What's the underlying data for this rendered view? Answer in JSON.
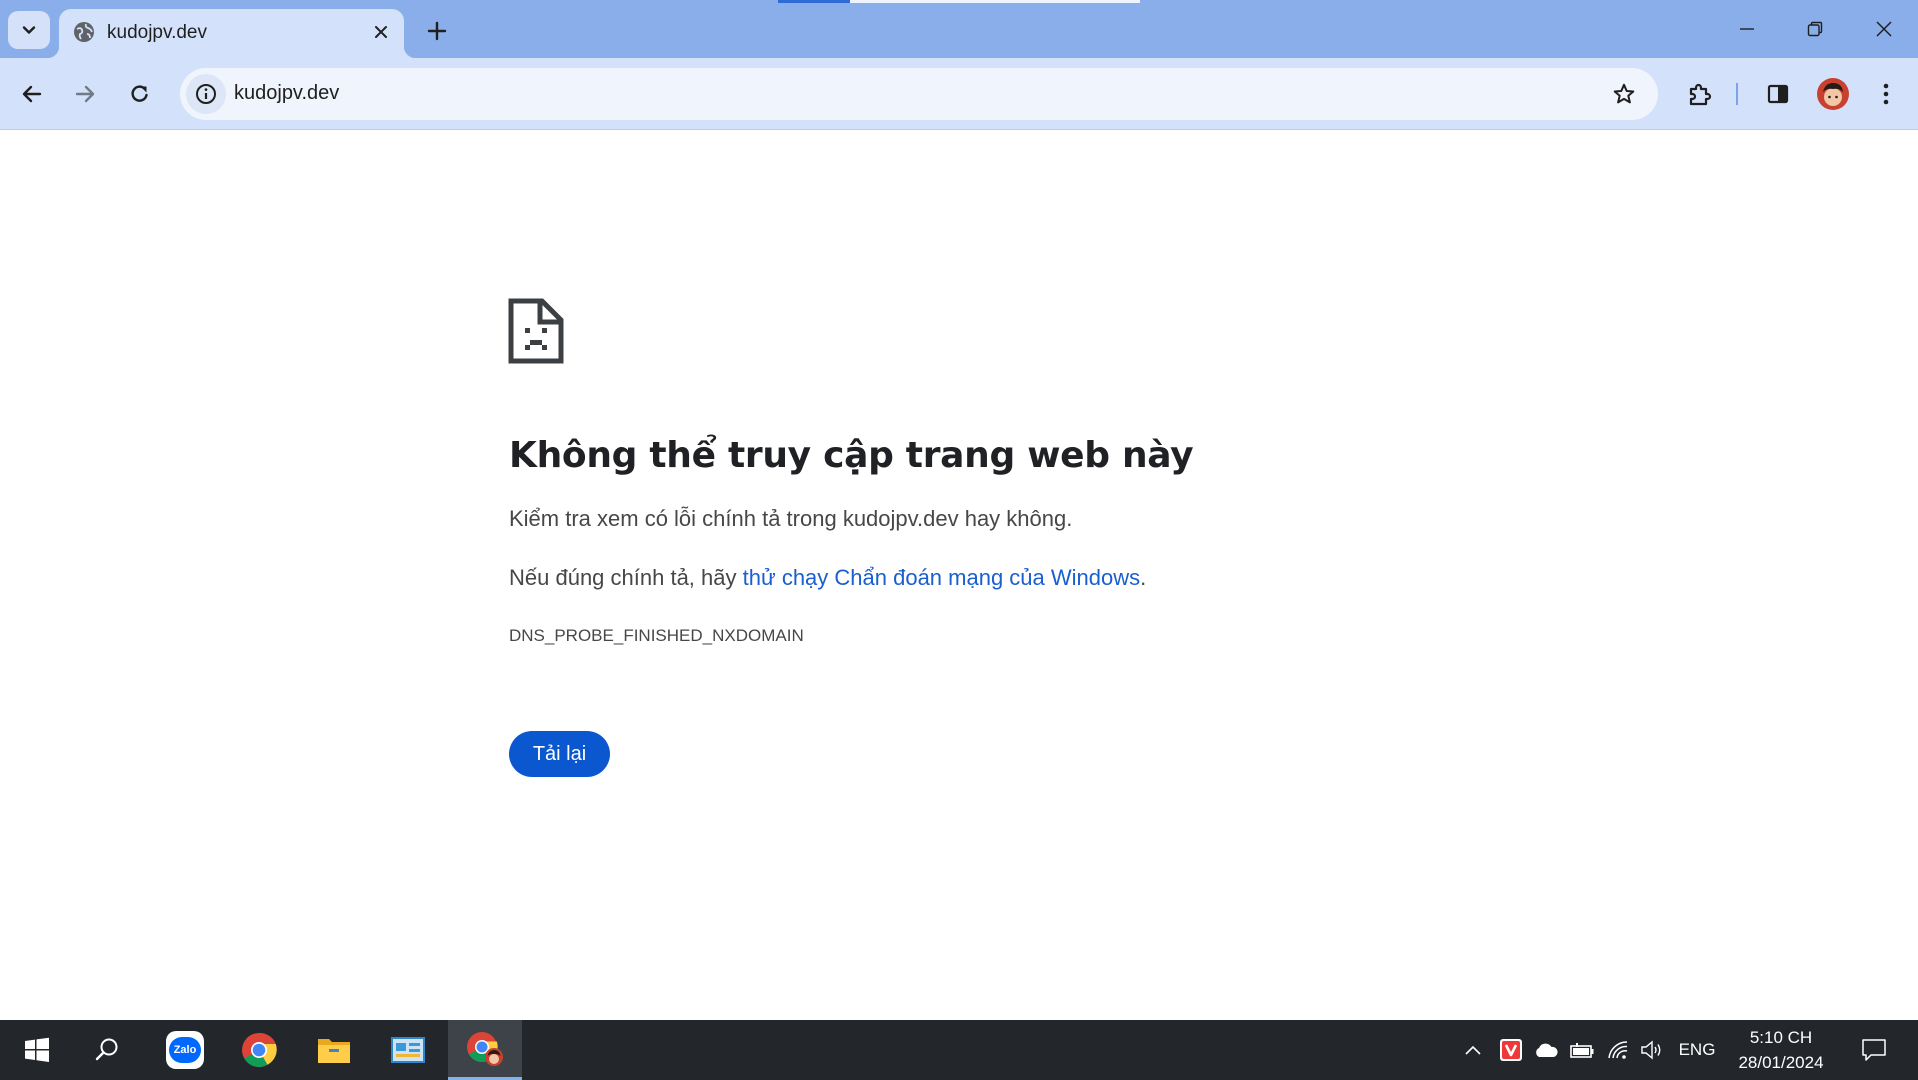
{
  "browser": {
    "tab": {
      "title": "kudojpv.dev",
      "favicon": "globe-icon",
      "close_icon": "close-icon"
    },
    "tab_search_icon": "chevron-down-icon",
    "new_tab_icon": "plus-icon",
    "window_controls": [
      "minimize-icon",
      "restore-icon",
      "close-icon"
    ],
    "toolbar": {
      "back_icon": "arrow-left-icon",
      "forward_icon": "arrow-right-icon",
      "reload_icon": "reload-icon",
      "site_info_icon": "info-icon",
      "url": "kudojpv.dev",
      "bookmark_icon": "star-icon",
      "extensions_icon": "puzzle-icon",
      "side_panel_icon": "side-panel-icon",
      "profile_icon": "avatar",
      "menu_icon": "kebab-menu-icon"
    },
    "colors": {
      "tabstrip": "#8aaee9",
      "toolbar": "#d3e2fa",
      "accent": "#0b57d0",
      "link": "#1a5fd0"
    }
  },
  "error_page": {
    "icon": "sad-document-icon",
    "title": "Không thể truy cập trang web này",
    "line1": "Kiểm tra xem có lỗi chính tả trong kudojpv.dev hay không.",
    "line2_prefix": "Nếu đúng chính tả, hãy ",
    "line2_link": "thử chạy Chẩn đoán mạng của Windows",
    "line2_suffix": ".",
    "error_code": "DNS_PROBE_FINISHED_NXDOMAIN",
    "reload_button": "Tải lại"
  },
  "taskbar": {
    "apps": [
      "windows-start-icon",
      "search-icon",
      "zalo-icon",
      "chrome-icon",
      "file-explorer-icon",
      "control-panel-icon",
      "chrome-profile-icon"
    ],
    "zalo_label": "Zalo",
    "tray": {
      "icons": [
        "chevron-up-icon",
        "vivaldi-icon",
        "onedrive-icon",
        "battery-icon",
        "wifi-icon",
        "volume-icon"
      ],
      "language": "ENG",
      "time": "5:10 CH",
      "date": "28/01/2024",
      "notification_icon": "notification-icon"
    }
  }
}
